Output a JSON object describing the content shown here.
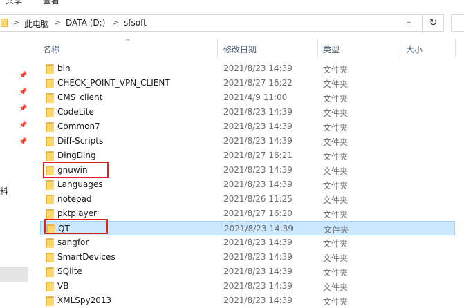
{
  "ribbon": {
    "item1": "共享",
    "item2": "查看"
  },
  "address": {
    "crumbs": [
      "此电脑",
      "DATA (D:)",
      "sfsoft"
    ],
    "separator": ">",
    "dropdown_glyph": "⌄",
    "refresh_glyph": "↻"
  },
  "nav": {
    "partial_label": "料"
  },
  "columns": {
    "name": "名称",
    "modified": "修改日期",
    "type": "类型",
    "size": "大小"
  },
  "files": [
    {
      "name": "bin",
      "modified": "2021/8/23 14:39",
      "type": "文件夹"
    },
    {
      "name": "CHECK_POINT_VPN_CLIENT",
      "modified": "2021/8/27 16:22",
      "type": "文件夹"
    },
    {
      "name": "CMS_client",
      "modified": "2021/4/9 11:00",
      "type": "文件夹"
    },
    {
      "name": "CodeLite",
      "modified": "2021/8/23 14:39",
      "type": "文件夹"
    },
    {
      "name": "Common7",
      "modified": "2021/8/23 14:39",
      "type": "文件夹"
    },
    {
      "name": "Diff-Scripts",
      "modified": "2021/8/23 14:39",
      "type": "文件夹"
    },
    {
      "name": "DingDing",
      "modified": "2021/8/27 16:21",
      "type": "文件夹"
    },
    {
      "name": "gnuwin",
      "modified": "2021/8/23 14:39",
      "type": "文件夹"
    },
    {
      "name": "Languages",
      "modified": "2021/8/23 14:39",
      "type": "文件夹"
    },
    {
      "name": "notepad",
      "modified": "2021/8/26 11:25",
      "type": "文件夹"
    },
    {
      "name": "pktplayer",
      "modified": "2021/8/27 16:20",
      "type": "文件夹"
    },
    {
      "name": "QT",
      "modified": "2021/8/23 14:39",
      "type": "文件夹"
    },
    {
      "name": "sangfor",
      "modified": "2021/8/23 14:39",
      "type": "文件夹"
    },
    {
      "name": "SmartDevices",
      "modified": "2021/8/23 14:39",
      "type": "文件夹"
    },
    {
      "name": "SQlite",
      "modified": "2021/8/23 14:39",
      "type": "文件夹"
    },
    {
      "name": "VB",
      "modified": "2021/8/23 14:39",
      "type": "文件夹"
    },
    {
      "name": "XMLSpy2013",
      "modified": "2021/8/23 14:39",
      "type": "文件夹"
    }
  ],
  "selected_row": "QT",
  "colors": {
    "selection_bg": "#cce8ff",
    "selection_border": "#99d1ff",
    "annotation": "#e02020",
    "folder": "#ffd768"
  }
}
